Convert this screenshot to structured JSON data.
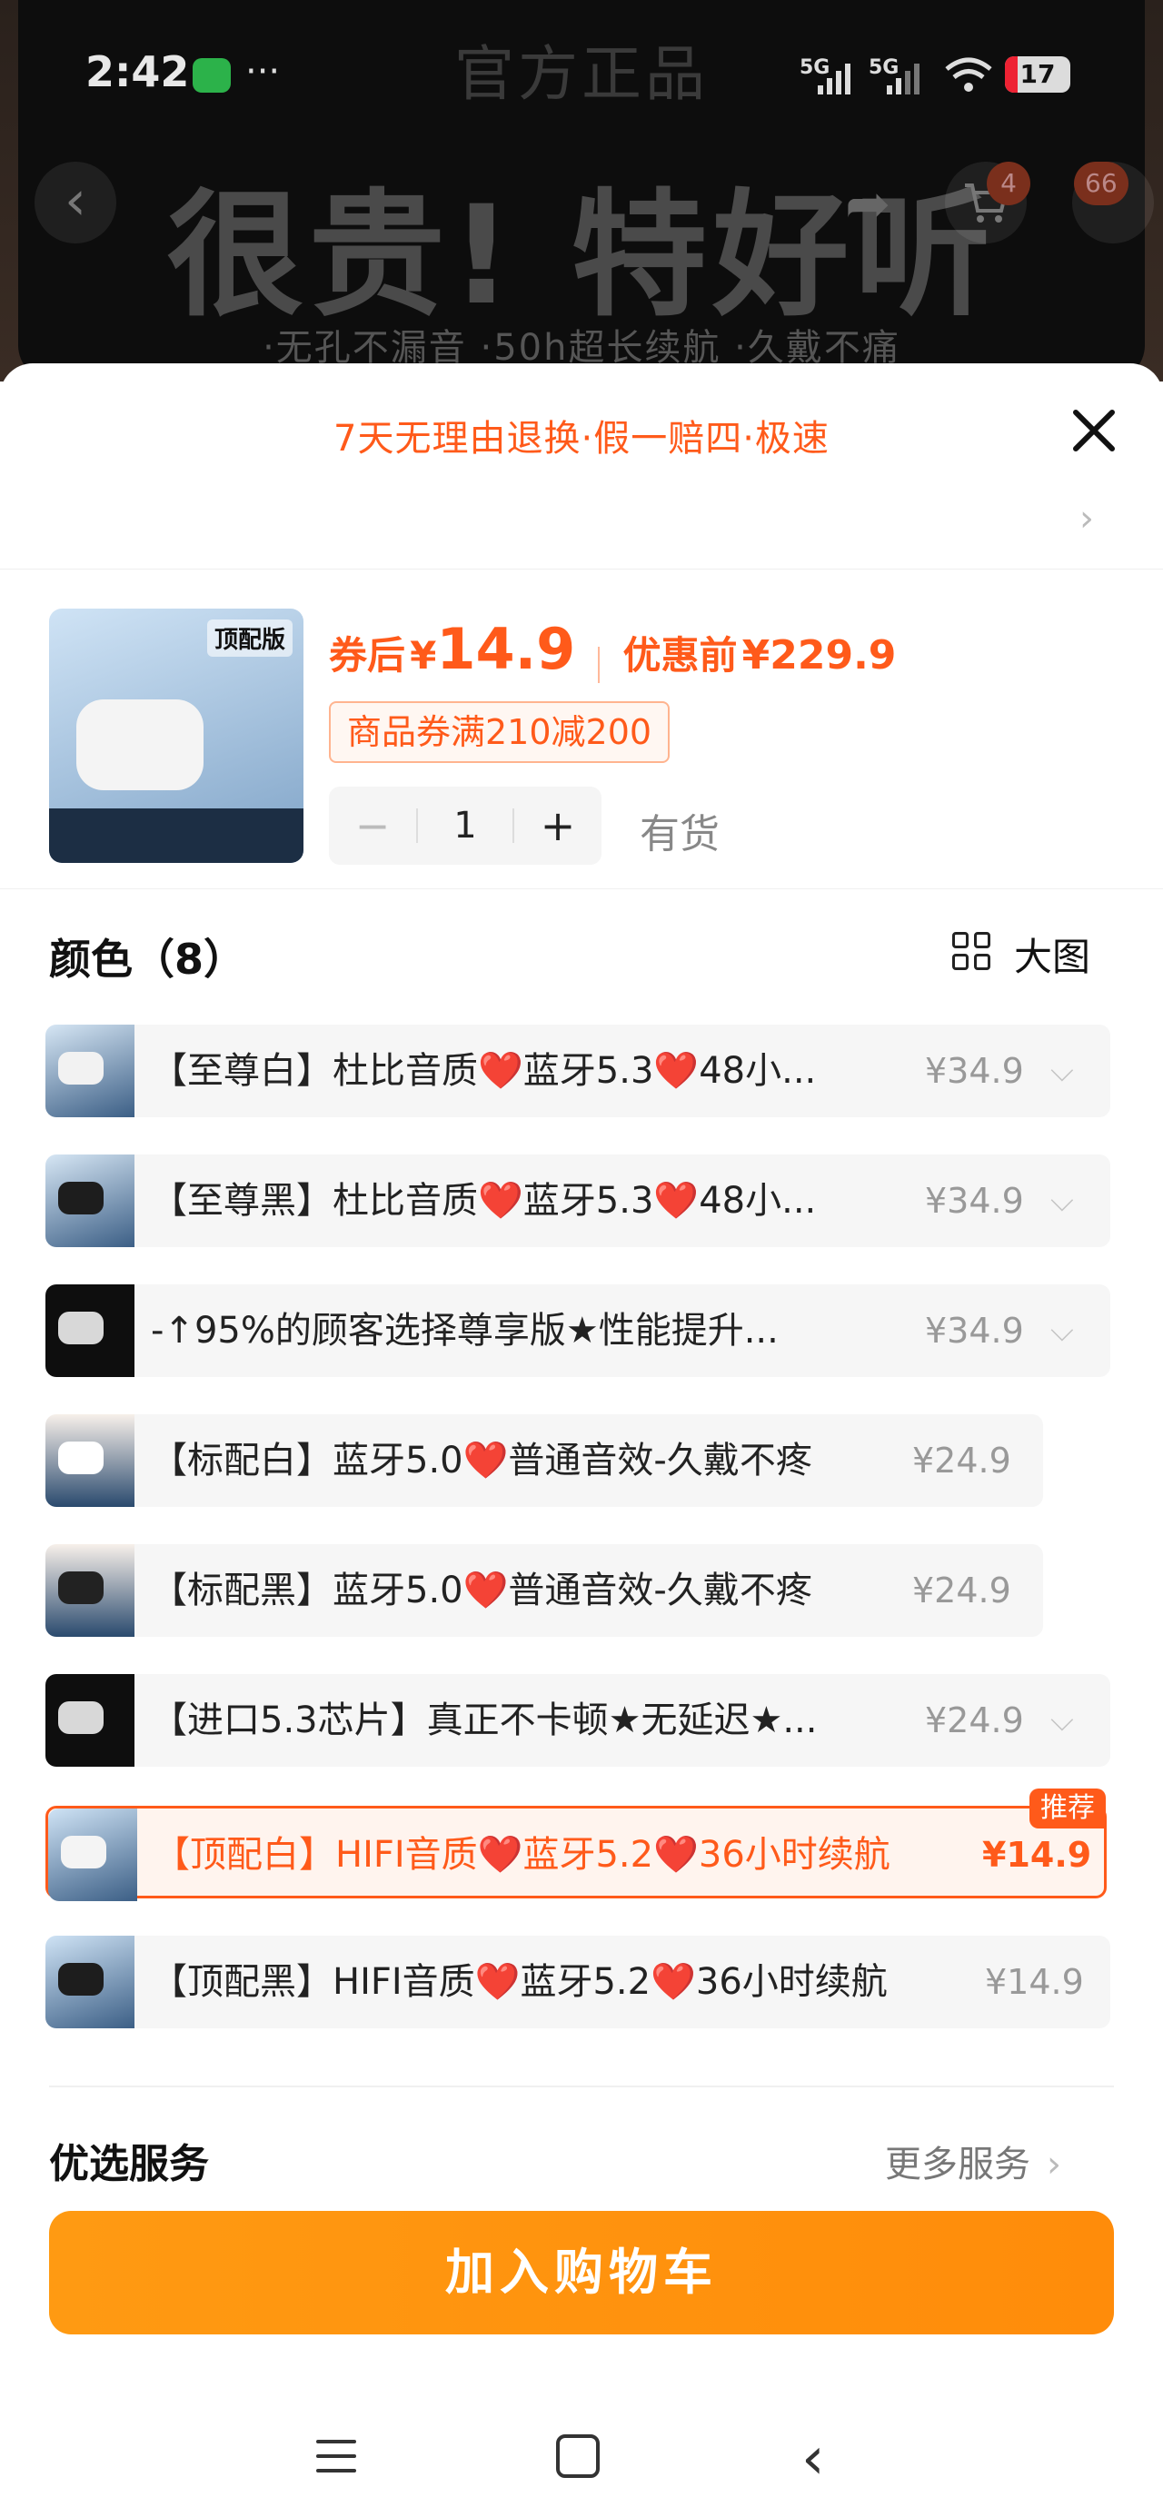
{
  "status_bar": {
    "time": "2:42",
    "signal_1": "5G",
    "signal_2": "5G",
    "battery": "17"
  },
  "background_page": {
    "top_title": "官方正品",
    "headline": "很贵! 特好听",
    "subline": "·无孔不漏音 ·50h超长续航 ·久戴不痛",
    "cart_badge": "4",
    "more_badge": "66"
  },
  "sheet": {
    "promo_text": "7天无理由退换·假一赔四·极速",
    "product": {
      "thumb_tag": "顶配版",
      "coupon_price_label": "券后",
      "coupon_price_currency": "¥",
      "coupon_price_value": "14.9",
      "original_price_label": "优惠前",
      "original_price": "¥229.9",
      "coupon_text": "商品券满210减200",
      "quantity": "1",
      "minus": "−",
      "plus": "+",
      "stock_status": "有货"
    },
    "color_section": {
      "title": "颜色（8）",
      "view_toggle_label": "大图"
    },
    "options": [
      {
        "label": "【至尊白】杜比音质❤️蓝牙5.3❤️48小...",
        "price": "¥34.9",
        "expandable": true
      },
      {
        "label": "【至尊黑】杜比音质❤️蓝牙5.3❤️48小...",
        "price": "¥34.9",
        "expandable": true
      },
      {
        "label": "-↑95%的顾客选择尊享版★性能提升...",
        "price": "¥34.9",
        "expandable": true
      },
      {
        "label": "【标配白】蓝牙5.0❤️普通音效-久戴不疼",
        "price": "¥24.9",
        "expandable": false
      },
      {
        "label": "【标配黑】蓝牙5.0❤️普通音效-久戴不疼",
        "price": "¥24.9",
        "expandable": false
      },
      {
        "label": "【进口5.3芯片】真正不卡顿★无延迟★...",
        "price": "¥24.9",
        "expandable": true
      },
      {
        "label": "【顶配白】HIFI音质❤️蓝牙5.2❤️36小时续航",
        "price": "¥14.9",
        "expandable": false,
        "selected": true,
        "badge": "推荐"
      },
      {
        "label": "【顶配黑】HIFI音质❤️蓝牙5.2❤️36小时续航",
        "price": "¥14.9",
        "expandable": false
      }
    ],
    "services": {
      "title": "优选服务",
      "more_label": "更多服务"
    },
    "add_to_cart_label": "加入购物车"
  },
  "colors": {
    "accent": "#ff5a1a",
    "cart_button": "#ff9410"
  }
}
